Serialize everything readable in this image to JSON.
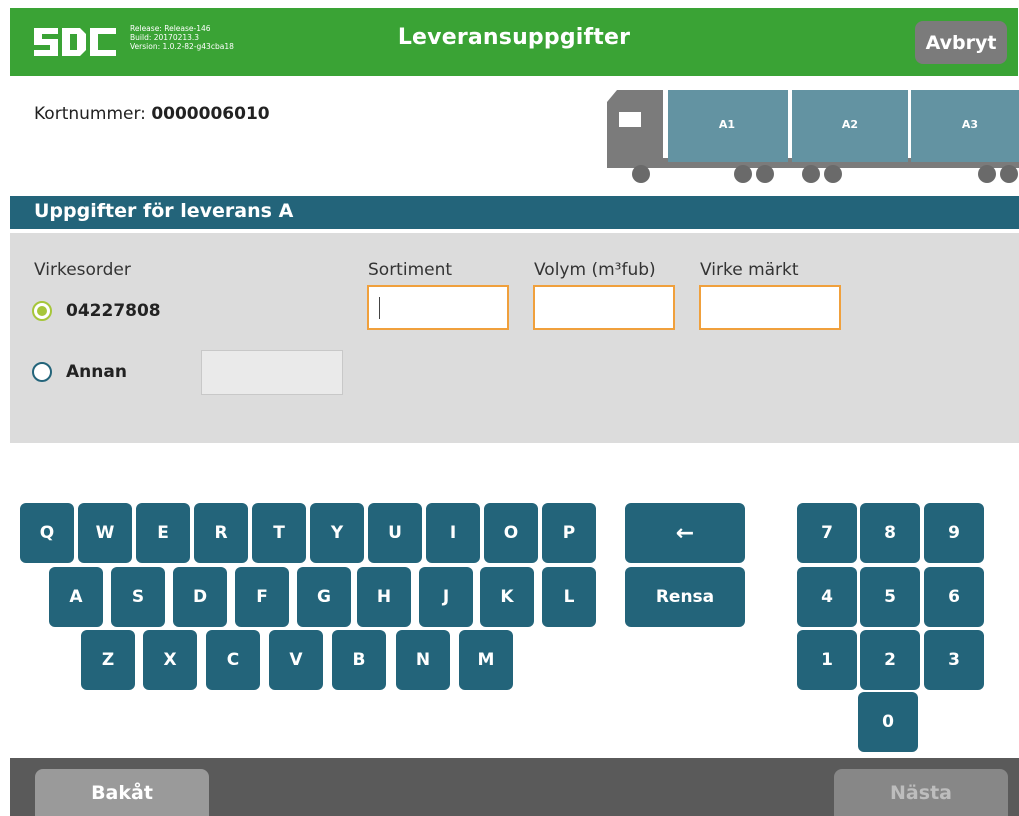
{
  "header": {
    "logo": "SDC",
    "release_line": "Release: Release-146",
    "build_line": "Build: 20170213.3",
    "version_line": "Version: 1.0.2-82-g43cba18",
    "title": "Leveransuppgifter",
    "cancel_label": "Avbryt"
  },
  "card": {
    "label": "Kortnummer:",
    "number": "0000006010"
  },
  "truck": {
    "compartments": [
      "A1",
      "A2",
      "A3"
    ],
    "colors": {
      "cargo": "#6393a2",
      "body": "#7b7b7b",
      "wheel": "#6a6a6a"
    }
  },
  "section": {
    "title": "Uppgifter för leverans A"
  },
  "form": {
    "virkesorder_label": "Virkesorder",
    "option_selected_label": "04227808",
    "option_other_label": "Annan",
    "other_value": "",
    "sortiment_label": "Sortiment",
    "sortiment_value": "",
    "volym_label": "Volym (m³fub)",
    "volym_value": "",
    "virke_label": "Virke märkt",
    "virke_value": ""
  },
  "keyboard": {
    "row1": [
      "Q",
      "W",
      "E",
      "R",
      "T",
      "Y",
      "U",
      "I",
      "O",
      "P"
    ],
    "row2": [
      "A",
      "S",
      "D",
      "F",
      "G",
      "H",
      "J",
      "K",
      "L"
    ],
    "row3": [
      "Z",
      "X",
      "C",
      "V",
      "B",
      "N",
      "M"
    ],
    "backspace": "←",
    "clear": "Rensa",
    "num_row1": [
      "7",
      "8",
      "9"
    ],
    "num_row2": [
      "4",
      "5",
      "6"
    ],
    "num_row3": [
      "1",
      "2",
      "3"
    ],
    "num_row4": [
      "0"
    ]
  },
  "footer": {
    "back_label": "Bakåt",
    "next_label": "Nästa"
  },
  "colors": {
    "header_green": "#3aa335",
    "teal": "#23647a",
    "input_border": "#f0a03c",
    "radio_selected": "#a6c63a",
    "panel_gray": "#dcdcdc",
    "footer_gray": "#5a5a5a"
  }
}
